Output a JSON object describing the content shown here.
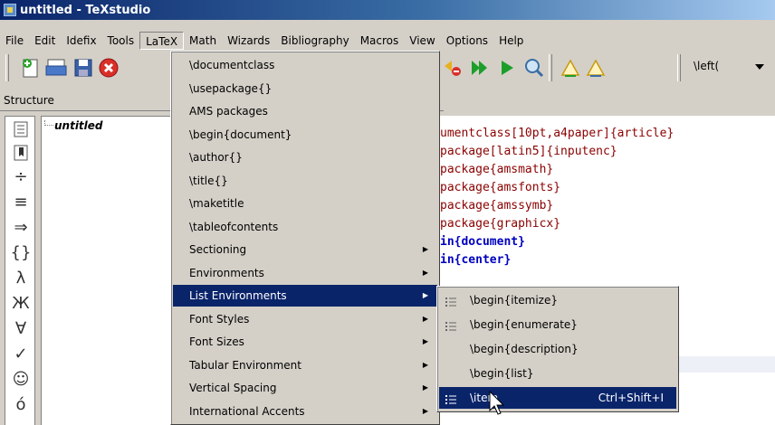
{
  "window": {
    "title": "untitled - TeXstudio"
  },
  "menubar": [
    "File",
    "Edit",
    "Idefix",
    "Tools",
    "LaTeX",
    "Math",
    "Wizards",
    "Bibliography",
    "Macros",
    "View",
    "Options",
    "Help"
  ],
  "toolbar": {
    "left_bracket": "\\left("
  },
  "structure": {
    "label": "Structure",
    "root": "untitled"
  },
  "editor": {
    "lines": [
      {
        "text": "umentclass[10pt,a4paper]{article}",
        "style": "red"
      },
      {
        "text": "package[latin5]{inputenc}",
        "style": "red"
      },
      {
        "text": "package{amsmath}",
        "style": "red"
      },
      {
        "text": "package{amsfonts}",
        "style": "red"
      },
      {
        "text": "package{amssymb}",
        "style": "red"
      },
      {
        "text": "package{graphicx}",
        "style": "red"
      },
      {
        "text": "in{document}",
        "style": "blue"
      },
      {
        "text": "in{center}",
        "style": "blue"
      }
    ]
  },
  "latex_menu": {
    "items": [
      {
        "label": "\\documentclass",
        "submenu": false
      },
      {
        "label": "\\usepackage{}",
        "submenu": false
      },
      {
        "label": "AMS packages",
        "submenu": false
      },
      {
        "label": "\\begin{document}",
        "submenu": false
      },
      {
        "label": "\\author{}",
        "submenu": false
      },
      {
        "label": "\\title{}",
        "submenu": false
      },
      {
        "label": "\\maketitle",
        "submenu": false
      },
      {
        "label": "\\tableofcontents",
        "submenu": false
      },
      {
        "label": "Sectioning",
        "submenu": true
      },
      {
        "label": "Environments",
        "submenu": true
      },
      {
        "label": "List Environments",
        "submenu": true,
        "selected": true
      },
      {
        "label": "Font Styles",
        "submenu": true
      },
      {
        "label": "Font Sizes",
        "submenu": true
      },
      {
        "label": "Tabular Environment",
        "submenu": true
      },
      {
        "label": "Vertical Spacing",
        "submenu": true
      },
      {
        "label": "International Accents",
        "submenu": true
      }
    ]
  },
  "list_submenu": {
    "items": [
      {
        "label": "\\begin{itemize}",
        "icon": "itemize-icon"
      },
      {
        "label": "\\begin{enumerate}",
        "icon": "enumerate-icon"
      },
      {
        "label": "\\begin{description}",
        "icon": ""
      },
      {
        "label": "\\begin{list}",
        "icon": ""
      },
      {
        "label": "\\item",
        "icon": "item-icon",
        "shortcut": "Ctrl+Shift+I",
        "selected": true
      }
    ]
  },
  "colors": {
    "selection": "#0a246a",
    "keyword_red": "#8b0000",
    "keyword_blue": "#0000c0"
  }
}
